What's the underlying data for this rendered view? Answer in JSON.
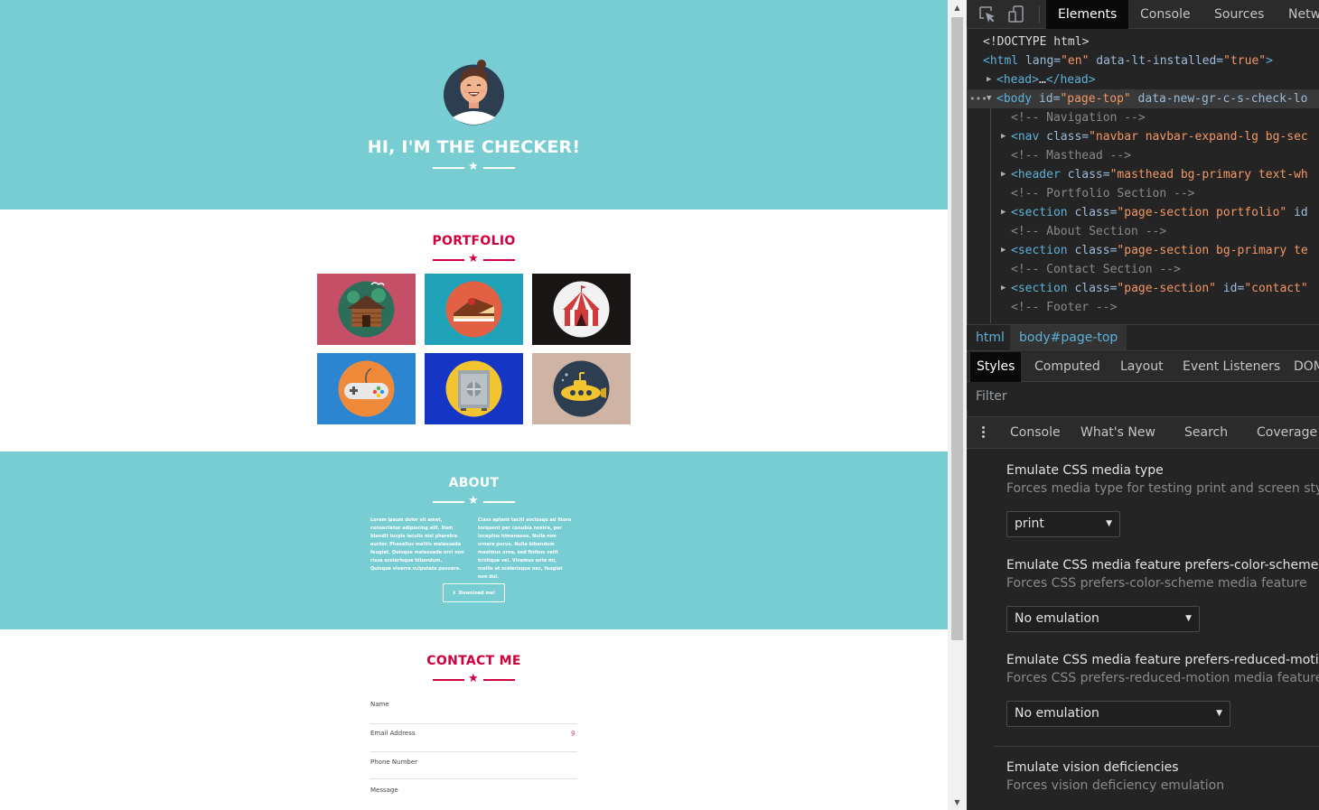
{
  "page": {
    "masthead_title": "HI, I'M THE CHECKER!",
    "portfolio_title": "PORTFOLIO",
    "portfolio_items": [
      {
        "icon": "log-cabin-icon",
        "bg": "#c44f67"
      },
      {
        "icon": "cake-icon",
        "bg": "#20a3b8"
      },
      {
        "icon": "circus-tent-icon",
        "bg": "#1a1515"
      },
      {
        "icon": "game-controller-icon",
        "bg": "#2b85d0"
      },
      {
        "icon": "safe-icon",
        "bg": "#1535c4"
      },
      {
        "icon": "submarine-icon",
        "bg": "#cfb4a6"
      }
    ],
    "about_title": "ABOUT",
    "about_col1": "Lorem ipsum dolor sit amet, consectetur adipiscing elit. Nam blandit turpis iaculis nisl pharetra auctor. Phasellus mattis malesuada feugiat. Quisque malesuada orci non risus scelerisque bibendum. Quisque viverra vulputate posuere.",
    "about_col2": "Class aptent taciti sociosqu ad litora torquent per conubia nostra, per inceptos himenaeos. Nulla non ornare purus. Nulla bibendum maximus urna, sed finibus velit tristique vel. Vivamus ante mi, mollis at scelerisque nec, feugiat non dui.",
    "download_label": "Download me!",
    "contact_title": "CONTACT ME",
    "contact_fields": [
      "Name",
      "Email Address",
      "Phone Number",
      "Message"
    ],
    "email_indicator": "g"
  },
  "devtools": {
    "toolbar_tabs": [
      "Elements",
      "Console",
      "Sources",
      "Netw"
    ],
    "active_tab": "Elements",
    "code_lines": [
      {
        "parts": [
          [
            "t-dt",
            "<!DOCTYPE html>"
          ]
        ]
      },
      {
        "parts": [
          [
            "t-tag",
            "<html "
          ],
          [
            "t-attr",
            "lang="
          ],
          [
            "t-val",
            "\"en\""
          ],
          [
            "t-attr",
            " data-lt-installed="
          ],
          [
            "t-val",
            "\"true\""
          ],
          [
            "t-tag",
            ">"
          ]
        ]
      },
      {
        "parts": [
          [
            "t-tag",
            "<head>"
          ],
          [
            "t-dt",
            "…"
          ],
          [
            "t-tag",
            "</head>"
          ]
        ]
      },
      {
        "parts": [
          [
            "t-tag",
            "<body "
          ],
          [
            "t-attr",
            "id="
          ],
          [
            "t-val",
            "\"page-top\""
          ],
          [
            "t-attr",
            " data-new-gr-c-s-check-lo"
          ]
        ]
      },
      {
        "parts": [
          [
            "t-cmt",
            "<!-- Navigation -->"
          ]
        ]
      },
      {
        "parts": [
          [
            "t-tag",
            "<nav "
          ],
          [
            "t-attr",
            "class="
          ],
          [
            "t-val",
            "\"navbar navbar-expand-lg bg-sec"
          ]
        ]
      },
      {
        "parts": [
          [
            "t-cmt",
            "<!-- Masthead -->"
          ]
        ]
      },
      {
        "parts": [
          [
            "t-tag",
            "<header "
          ],
          [
            "t-attr",
            "class="
          ],
          [
            "t-val",
            "\"masthead bg-primary text-wh"
          ]
        ]
      },
      {
        "parts": [
          [
            "t-cmt",
            "<!-- Portfolio Section -->"
          ]
        ]
      },
      {
        "parts": [
          [
            "t-tag",
            "<section "
          ],
          [
            "t-attr",
            "class="
          ],
          [
            "t-val",
            "\"page-section portfolio\""
          ],
          [
            "t-attr",
            " id"
          ]
        ]
      },
      {
        "parts": [
          [
            "t-cmt",
            "<!-- About Section -->"
          ]
        ]
      },
      {
        "parts": [
          [
            "t-tag",
            "<section "
          ],
          [
            "t-attr",
            "class="
          ],
          [
            "t-val",
            "\"page-section bg-primary te"
          ]
        ]
      },
      {
        "parts": [
          [
            "t-cmt",
            "<!-- Contact Section -->"
          ]
        ]
      },
      {
        "parts": [
          [
            "t-tag",
            "<section "
          ],
          [
            "t-attr",
            "class="
          ],
          [
            "t-val",
            "\"page-section\""
          ],
          [
            "t-attr",
            " id="
          ],
          [
            "t-val",
            "\"contact\""
          ]
        ]
      },
      {
        "parts": [
          [
            "t-cmt",
            "<!-- Footer -->"
          ]
        ]
      }
    ],
    "breadcrumbs": [
      "html",
      "body#page-top"
    ],
    "styles_tabs": [
      "Styles",
      "Computed",
      "Layout",
      "Event Listeners",
      "DOM"
    ],
    "filter_placeholder": "Filter",
    "drawer_tabs": [
      "Console",
      "What's New",
      "Search",
      "Coverage"
    ],
    "options": [
      {
        "title": "Emulate CSS media type",
        "desc": "Forces media type for testing print and screen styles",
        "value": "print"
      },
      {
        "title": "Emulate CSS media feature prefers-color-scheme",
        "desc": "Forces CSS prefers-color-scheme media feature",
        "value": "No emulation"
      },
      {
        "title": "Emulate CSS media feature prefers-reduced-motion",
        "desc": "Forces CSS prefers-reduced-motion media feature",
        "value": "No emulation"
      },
      {
        "title": "Emulate vision deficiencies",
        "desc": "Forces vision deficiency emulation"
      }
    ]
  },
  "colors": {
    "primary": "#78cdd3",
    "secondary": "#d1003d",
    "devtools_bg": "#242424"
  }
}
